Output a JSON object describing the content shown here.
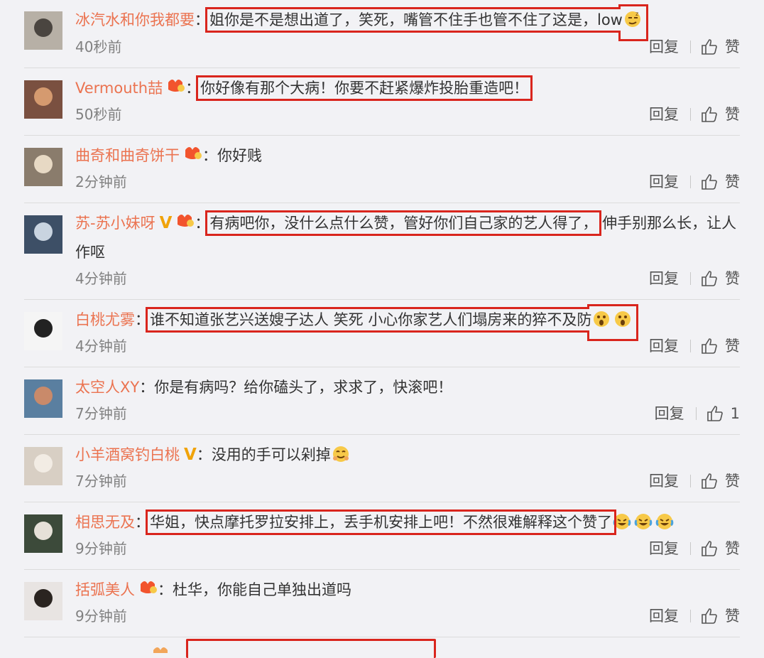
{
  "comments": [
    {
      "user": "冰汽水和你我都要",
      "badge": "",
      "text": "姐你是不是想出道了，笑死，嘴管不住手也管不住了这是，low",
      "emojis": [
        "smug"
      ],
      "highlighted": true,
      "time": "40秒前",
      "reply": "回复",
      "like": "赞"
    },
    {
      "user": "Vermouth喆",
      "badge": "fan-badge",
      "text": "你好像有那个大病！你要不赶紧爆炸投胎重造吧！",
      "emojis": [],
      "highlighted": true,
      "time": "50秒前",
      "reply": "回复",
      "like": "赞"
    },
    {
      "user": "曲奇和曲奇饼干",
      "badge": "fan-badge",
      "text": "你好贱",
      "emojis": [],
      "highlighted": false,
      "time": "2分钟前",
      "reply": "回复",
      "like": "赞"
    },
    {
      "user": "苏-苏小妹呀",
      "badge": "v-and-fan-badge",
      "text": "有病吧你，没什么点什么赞，管好你们自己家的艺人得了，",
      "text_rest": "伸手别那么长，让人作呕",
      "emojis": [],
      "highlighted": true,
      "time": "4分钟前",
      "reply": "回复",
      "like": "赞"
    },
    {
      "user": "白桃尤雾",
      "badge": "",
      "text": "谁不知道张艺兴送嫂子达人 笑死 小心你家艺人们塌房来的猝不及防",
      "emojis": [
        "shock",
        "shock"
      ],
      "highlighted": true,
      "time": "4分钟前",
      "reply": "回复",
      "like": "赞"
    },
    {
      "user": "太空人XY",
      "badge": "",
      "text": "你是有病吗？给你磕头了，求求了，快滚吧！",
      "emojis": [],
      "highlighted": false,
      "time": "7分钟前",
      "reply": "回复",
      "like": "1"
    },
    {
      "user": "小羊酒窝钓白桃",
      "badge": "v-badge",
      "text": "没用的手可以剁掉",
      "emojis": [
        "hug"
      ],
      "highlighted": false,
      "time": "7分钟前",
      "reply": "回复",
      "like": "赞"
    },
    {
      "user": "相思无及",
      "badge": "",
      "text": "华姐，快点摩托罗拉安排上，丢手机安排上吧！不然很难解释这个赞了",
      "emojis": [
        "laugh-cry",
        "laugh-cry",
        "laugh-cry"
      ],
      "highlighted": true,
      "time": "9分钟前",
      "reply": "回复",
      "like": "赞"
    },
    {
      "user": "括弧美人",
      "badge": "fan-badge",
      "text": "杜华，你能自己单独出道吗",
      "emojis": [],
      "highlighted": false,
      "time": "9分钟前",
      "reply": "回复",
      "like": "赞"
    }
  ],
  "colors": {
    "username": "#eb7350",
    "highlight": "#d9251d",
    "meta": "#808080",
    "background": "#f2f2f5",
    "vip": "#f0a30a"
  },
  "icons": {
    "like": "thumbs-up-icon",
    "fan": "fan-badge-icon",
    "verified": "v-badge-icon"
  }
}
